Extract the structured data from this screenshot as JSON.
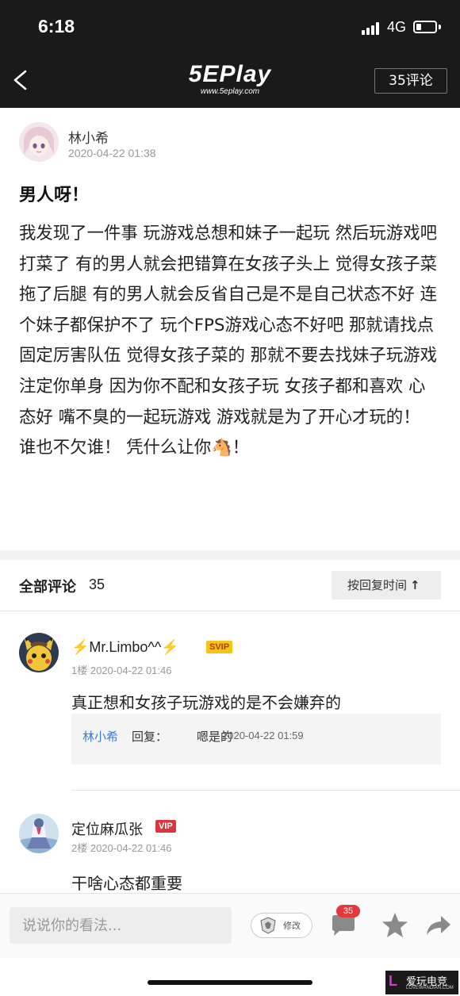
{
  "status_bar": {
    "time": "6:18",
    "network": "4G"
  },
  "nav": {
    "logo": "5EPlay",
    "logo_sub": "www.5eplay.com",
    "comment_count_label": "35评论"
  },
  "post": {
    "author": "林小希",
    "time": "2020-04-22 01:38",
    "title": "男人呀！",
    "body": "我发现了一件事 玩游戏总想和妹子一起玩 然后玩游戏吧打菜了 有的男人就会把错算在女孩子头上 觉得女孩子菜拖了后腿 有的男人就会反省自己是不是自己状态不好 连个妹子都保护不了 玩个FPS游戏心态不好吧 那就请找点固定厉害队伍 觉得女孩子菜的 那就不要去找妹子玩游戏 注定你单身 因为你不配和女孩子玩 女孩子都和喜欢 心态好 嘴不臭的一起玩游戏 游戏就是为了开心才玩的！ 谁也不欠谁！ 凭什么让你🐴！"
  },
  "comments_header": {
    "label": "全部评论",
    "count": "35",
    "sort_label": "按回复时间",
    "sort_arrow": "↑"
  },
  "comments": [
    {
      "name": "⚡Mr.Limbo^^⚡",
      "badge": "SVIP",
      "meta": "1楼 2020-04-22 01:46",
      "text": "真正想和女孩子玩游戏的是不会嫌弃的",
      "reply": {
        "author": "林小希",
        "label": "回复：",
        "text": "嗯是的",
        "time": "2020-04-22 01:59"
      }
    },
    {
      "name": "定位麻瓜张",
      "badge": "VIP",
      "meta": "2楼 2020-04-22 01:46",
      "text": "干啥心态都重要"
    }
  ],
  "bottom_bar": {
    "input_placeholder": "说说你的看法...",
    "edit_label": "修改",
    "comment_badge": "35"
  },
  "watermark": {
    "mark": "L",
    "text": "爱玩电竞",
    "sub": "LOVEWANDIAN.COM"
  },
  "colors": {
    "header_bg": "#1a1a1a",
    "link_blue": "#3a7bd5",
    "badge_red": "#e23a3a",
    "svip_gold": "#f5c518"
  }
}
